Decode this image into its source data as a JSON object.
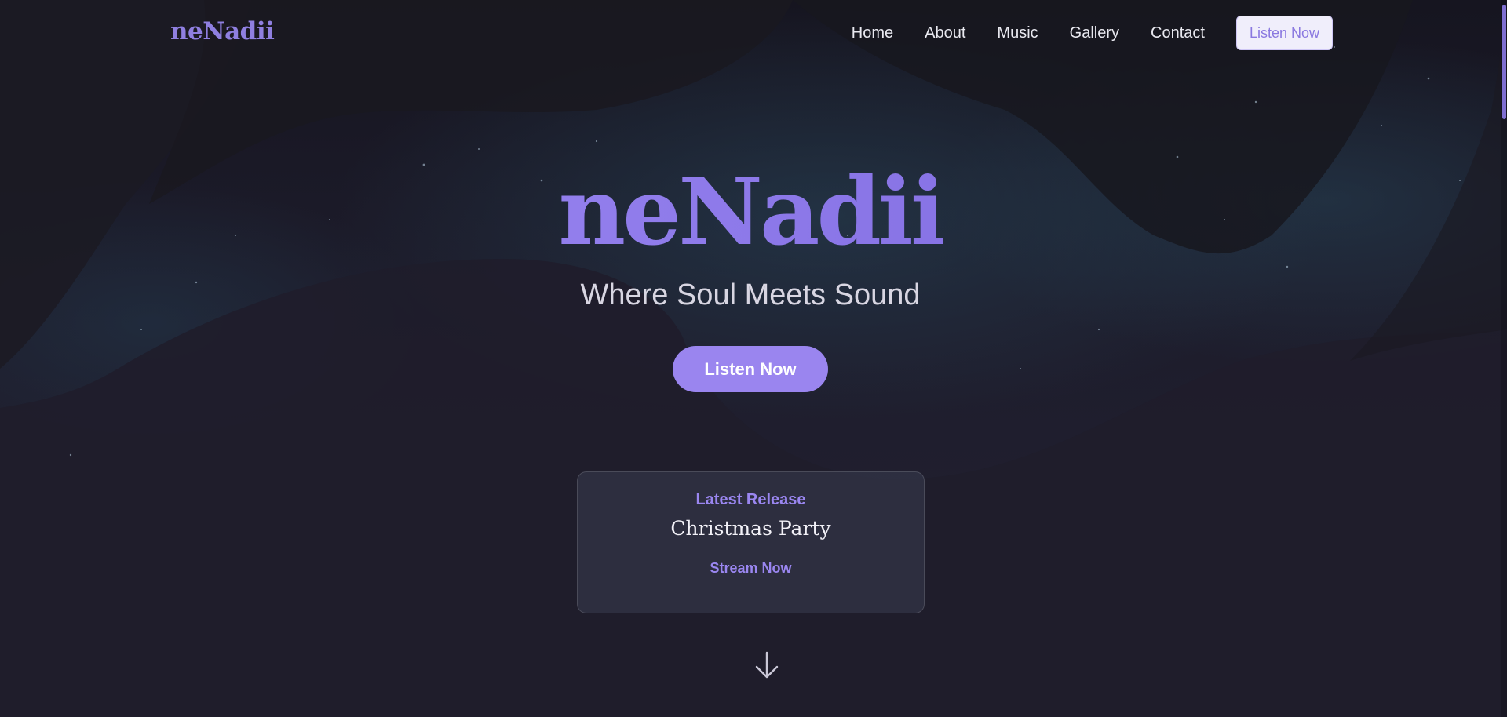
{
  "header": {
    "logo": "neNadii",
    "nav": [
      "Home",
      "About",
      "Music",
      "Gallery",
      "Contact"
    ],
    "cta_label": "Listen Now"
  },
  "hero": {
    "title": "neNadii",
    "tagline": "Where Soul Meets Sound",
    "cta_label": "Listen Now"
  },
  "latest_release": {
    "label": "Latest Release",
    "title": "Christmas Party",
    "link_label": "Stream Now"
  },
  "icons": {
    "scroll_down": "arrow-down-icon"
  },
  "colors": {
    "accent": "#9a86f0",
    "background": "#1d1c2b",
    "text": "#e9e9f0"
  }
}
